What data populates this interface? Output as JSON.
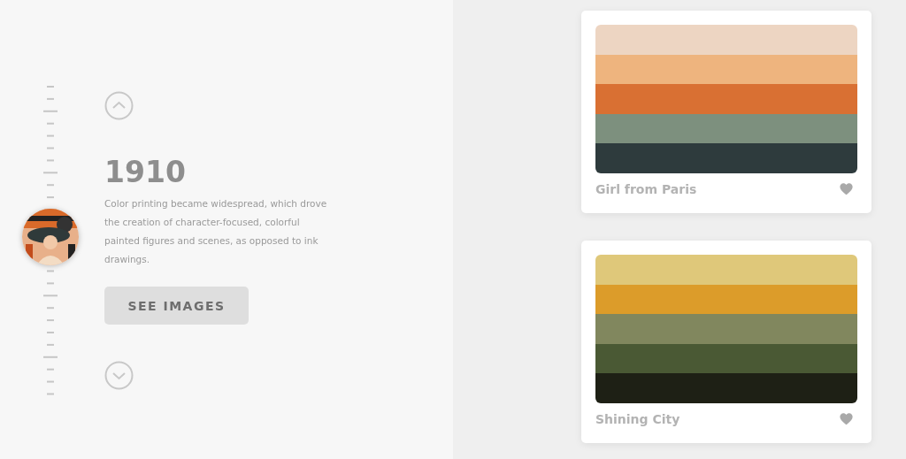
{
  "timeline": {
    "year": "1910",
    "description": "Color printing became widespread, which drove the creation of character-focused, colorful painted figures and scenes, as opposed to ink drawings.",
    "button": "SEE IMAGES"
  },
  "palettes": [
    {
      "name": "Girl from Paris",
      "swatches": [
        {
          "color": "#edd5c2"
        },
        {
          "color": "#eeb47e"
        },
        {
          "color": "#d97033"
        },
        {
          "color": "#7d907e"
        },
        {
          "color": "#2e3b3d"
        }
      ]
    },
    {
      "name": "Shining City",
      "swatches": [
        {
          "color": "#dfc87a"
        },
        {
          "color": "#dc9c2a"
        },
        {
          "color": "#81875e"
        },
        {
          "color": "#4a5934"
        },
        {
          "color": "#1e2015"
        }
      ]
    }
  ]
}
